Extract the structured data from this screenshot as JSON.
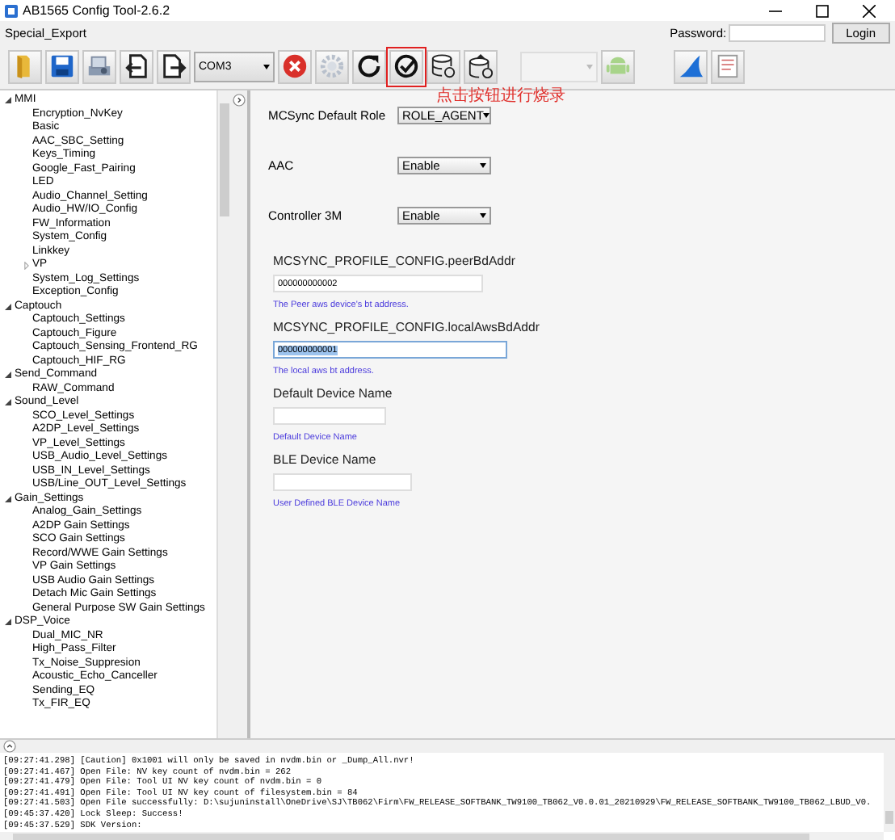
{
  "window": {
    "title": "AB1565 Config Tool-2.6.2"
  },
  "menu": {
    "items": [
      "Special_Export"
    ],
    "password_label": "Password:",
    "login": "Login"
  },
  "toolbar": {
    "port": "COM3",
    "annotation": "点击按钮进行烧录"
  },
  "tree": [
    {
      "label": "MMI",
      "expanded": true,
      "children": [
        {
          "label": "Encryption_NvKey"
        },
        {
          "label": "Basic"
        },
        {
          "label": "AAC_SBC_Setting"
        },
        {
          "label": "Keys_Timing"
        },
        {
          "label": "Google_Fast_Pairing"
        },
        {
          "label": "LED"
        },
        {
          "label": "Audio_Channel_Setting"
        },
        {
          "label": "Audio_HW/IO_Config"
        },
        {
          "label": "FW_Information"
        },
        {
          "label": "System_Config"
        },
        {
          "label": "Linkkey"
        },
        {
          "label": "VP",
          "expanded": false
        },
        {
          "label": "System_Log_Settings"
        },
        {
          "label": "Exception_Config"
        }
      ]
    },
    {
      "label": "Captouch",
      "expanded": true,
      "children": [
        {
          "label": "Captouch_Settings"
        },
        {
          "label": "Captouch_Figure"
        },
        {
          "label": "Captouch_Sensing_Frontend_RG"
        },
        {
          "label": "Captouch_HIF_RG"
        }
      ]
    },
    {
      "label": "Send_Command",
      "expanded": true,
      "children": [
        {
          "label": "RAW_Command"
        }
      ]
    },
    {
      "label": "Sound_Level",
      "expanded": true,
      "children": [
        {
          "label": "SCO_Level_Settings"
        },
        {
          "label": "A2DP_Level_Settings"
        },
        {
          "label": "VP_Level_Settings"
        },
        {
          "label": "USB_Audio_Level_Settings"
        },
        {
          "label": "USB_IN_Level_Settings"
        },
        {
          "label": "USB/Line_OUT_Level_Settings"
        }
      ]
    },
    {
      "label": "Gain_Settings",
      "expanded": true,
      "children": [
        {
          "label": "Analog_Gain_Settings"
        },
        {
          "label": "A2DP Gain Settings"
        },
        {
          "label": "SCO Gain Settings"
        },
        {
          "label": "Record/WWE Gain Settings"
        },
        {
          "label": "VP Gain Settings"
        },
        {
          "label": "USB Audio Gain Settings"
        },
        {
          "label": "Detach Mic Gain Settings"
        },
        {
          "label": "General Purpose SW Gain Settings"
        }
      ]
    },
    {
      "label": "DSP_Voice",
      "expanded": true,
      "children": [
        {
          "label": "Dual_MIC_NR"
        },
        {
          "label": "High_Pass_Filter"
        },
        {
          "label": "Tx_Noise_Suppresion"
        },
        {
          "label": "Acoustic_Echo_Canceller"
        },
        {
          "label": "Sending_EQ"
        },
        {
          "label": "Tx_FIR_EQ"
        }
      ]
    }
  ],
  "fields": [
    {
      "kind": "select",
      "label": "MCSync Default Role",
      "value": "ROLE_AGENT"
    },
    {
      "kind": "select",
      "label": "AAC",
      "value": "Enable"
    },
    {
      "kind": "select",
      "label": "Controller 3M",
      "value": "Enable"
    },
    {
      "kind": "text",
      "label": "MCSYNC_PROFILE_CONFIG.peerBdAddr",
      "value": "000000000002",
      "hint": "The Peer aws device's bt address.",
      "selected": false
    },
    {
      "kind": "text",
      "label": "MCSYNC_PROFILE_CONFIG.localAwsBdAddr",
      "value": "000000000001",
      "hint": "The local aws bt address.",
      "selected": true
    },
    {
      "kind": "text",
      "label": "Default Device Name",
      "hint": "Default Device Name",
      "selected": false
    },
    {
      "kind": "text",
      "label": "BLE Device Name",
      "hint": "User Defined BLE Device Name",
      "selected": false
    }
  ],
  "log": [
    "[09:27:41.298] [Caution] 0x1001 will only be saved in nvdm.bin or _Dump_All.nvr!",
    "[09:27:41.467] Open File: NV key count of nvdm.bin = 262",
    "[09:27:41.479] Open File: Tool UI NV key count of nvdm.bin = 0",
    "[09:27:41.491] Open File: Tool UI NV key count of filesystem.bin = 84",
    "[09:27:41.503] Open File successfully: D:\\sujuninstall\\OneDrive\\SJ\\TB062\\Firm\\FW_RELEASE_SOFTBANK_TW9100_TB062_V0.0.01_20210929\\FW_RELEASE_SOFTBANK_TW9100_TB062_LBUD_V0.",
    "[09:45:37.420] Lock Sleep: Success!",
    "[09:45:37.529] SDK Version:"
  ]
}
